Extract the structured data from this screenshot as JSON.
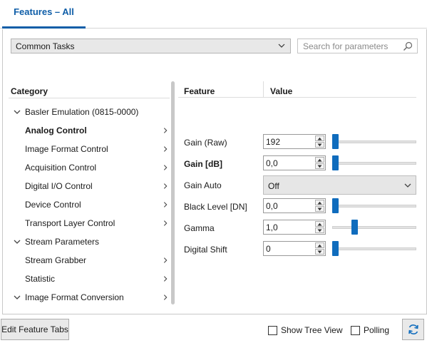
{
  "tabs": {
    "active_label": "Features – All"
  },
  "toolbar": {
    "task_select_value": "Common Tasks",
    "search_placeholder": "Search for parameters"
  },
  "category": {
    "header": "Category",
    "items": [
      {
        "label": "Basler Emulation (0815-0000)",
        "expanded": true,
        "bold": false,
        "arrow": false,
        "icon": "chevron-down-icon"
      },
      {
        "label": "Analog Control",
        "bold": true,
        "arrow": true,
        "icon": "chevron-right-icon"
      },
      {
        "label": "Image Format Control",
        "bold": false,
        "arrow": true,
        "icon": "chevron-right-icon"
      },
      {
        "label": "Acquisition Control",
        "bold": false,
        "arrow": true,
        "icon": "chevron-right-icon"
      },
      {
        "label": "Digital I/O Control",
        "bold": false,
        "arrow": true,
        "icon": "chevron-right-icon"
      },
      {
        "label": "Device Control",
        "bold": false,
        "arrow": true,
        "icon": "chevron-right-icon"
      },
      {
        "label": "Transport Layer Control",
        "bold": false,
        "arrow": true,
        "icon": "chevron-right-icon"
      },
      {
        "label": "Stream Parameters",
        "expanded": true,
        "bold": false,
        "arrow": false,
        "icon": "chevron-down-icon"
      },
      {
        "label": "Stream Grabber",
        "bold": false,
        "arrow": true,
        "icon": "chevron-right-icon"
      },
      {
        "label": "Statistic",
        "bold": false,
        "arrow": true,
        "icon": "chevron-right-icon"
      },
      {
        "label": "Image Format Conversion",
        "expanded": true,
        "bold": false,
        "arrow": true,
        "icon": "chevron-down-icon"
      }
    ]
  },
  "features": {
    "feature_header": "Feature",
    "value_header": "Value",
    "rows": [
      {
        "label": "Gain (Raw)",
        "bold": false,
        "type": "spin",
        "value": "192",
        "slider_fraction": 0.0
      },
      {
        "label": "Gain [dB]",
        "bold": true,
        "type": "spin",
        "value": "0,0",
        "slider_fraction": 0.0
      },
      {
        "label": "Gain Auto",
        "bold": false,
        "type": "dropdown",
        "value": "Off"
      },
      {
        "label": "Black Level [DN]",
        "bold": false,
        "type": "spin",
        "value": "0,0",
        "slider_fraction": 0.0
      },
      {
        "label": "Gamma",
        "bold": false,
        "type": "spin",
        "value": "1,0",
        "slider_fraction": 0.25
      },
      {
        "label": "Digital Shift",
        "bold": false,
        "type": "spin",
        "value": "0",
        "slider_fraction": 0.0
      }
    ]
  },
  "footer": {
    "edit_tabs_label": "Edit Feature Tabs",
    "show_tree_view_label": "Show Tree View",
    "show_tree_view_checked": false,
    "polling_label": "Polling",
    "polling_checked": false
  },
  "colors": {
    "accent": "#0f5ea8",
    "slider_thumb": "#0f6cbd"
  }
}
